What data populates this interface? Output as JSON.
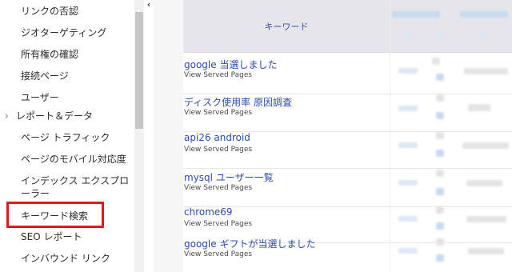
{
  "sidebar": {
    "items": [
      {
        "label": "リンクの否認"
      },
      {
        "label": "ジオターゲティング"
      },
      {
        "label": "所有権の確認"
      },
      {
        "label": "接続ページ"
      },
      {
        "label": "ユーザー"
      },
      {
        "label": "レポート＆データ",
        "expandable": true
      },
      {
        "label": "ページ トラフィック"
      },
      {
        "label": "ページのモバイル対応度"
      },
      {
        "label": "インデックス エクスプローラー"
      },
      {
        "label": "キーワード検索",
        "highlighted": true
      },
      {
        "label": "SEO レポート"
      },
      {
        "label": "インバウンド リンク"
      }
    ],
    "expander_glyph": "›",
    "collapse_glyph": "‹"
  },
  "table": {
    "header": {
      "keyword": "キーワード"
    },
    "rows": [
      {
        "keyword": "google 当選しました",
        "sub": "View Served Pages"
      },
      {
        "keyword": "ディスク使用率 原因調査",
        "sub": "View Served Pages"
      },
      {
        "keyword": "api26 android",
        "sub": "View Served Pages"
      },
      {
        "keyword": "mysql ユーザー一覧",
        "sub": "View Served Pages"
      },
      {
        "keyword": "chrome69",
        "sub": "View Served Pages"
      },
      {
        "keyword": "google ギフトが当選しました",
        "sub": "View Served Pages"
      }
    ]
  },
  "colors": {
    "highlight": "#e8141c",
    "link": "#2c4ab5",
    "header_bg": "#e6e6ea"
  }
}
